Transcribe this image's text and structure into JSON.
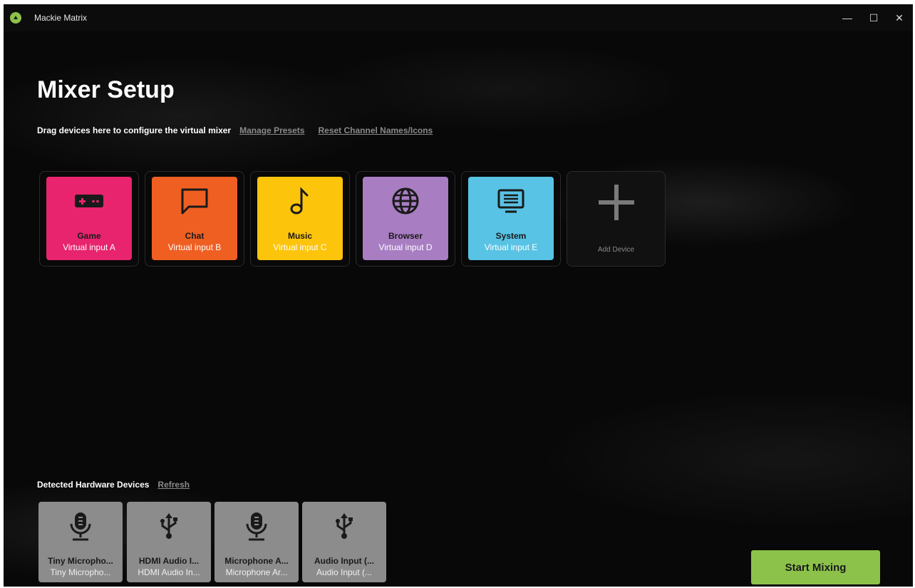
{
  "window": {
    "title": "Mackie Matrix",
    "controls": {
      "minimize": "—",
      "maximize": "☐",
      "close": "✕"
    }
  },
  "header": {
    "title": "Mixer Setup",
    "instruction": "Drag devices here to configure the virtual mixer",
    "manage_presets": "Manage Presets",
    "reset_names": "Reset Channel Names/Icons"
  },
  "channels": [
    {
      "name": "Game",
      "sub": "Virtual input A",
      "color": "#e8246e",
      "icon": "gamepad-icon"
    },
    {
      "name": "Chat",
      "sub": "Virtual input B",
      "color": "#ef5f22",
      "icon": "chat-bubble-icon"
    },
    {
      "name": "Music",
      "sub": "Virtual input C",
      "color": "#fdc40c",
      "icon": "music-note-icon"
    },
    {
      "name": "Browser",
      "sub": "Virtual input D",
      "color": "#a87dc2",
      "icon": "globe-icon"
    },
    {
      "name": "System",
      "sub": "Virtual input E",
      "color": "#58c3e4",
      "icon": "monitor-icon"
    }
  ],
  "add_device": {
    "label": "Add Device",
    "icon": "plus-icon"
  },
  "hardware": {
    "title": "Detected Hardware Devices",
    "refresh": "Refresh",
    "devices": [
      {
        "name": "Tiny Micropho...",
        "sub": "Tiny Micropho...",
        "icon": "microphone-icon"
      },
      {
        "name": "HDMI Audio I...",
        "sub": "HDMI Audio In...",
        "icon": "usb-icon"
      },
      {
        "name": "Microphone A...",
        "sub": "Microphone Ar...",
        "icon": "microphone-icon"
      },
      {
        "name": "Audio Input (...",
        "sub": "Audio Input (...",
        "icon": "usb-icon"
      }
    ]
  },
  "start_button": {
    "label": "Start Mixing",
    "color": "#8cc24a"
  }
}
